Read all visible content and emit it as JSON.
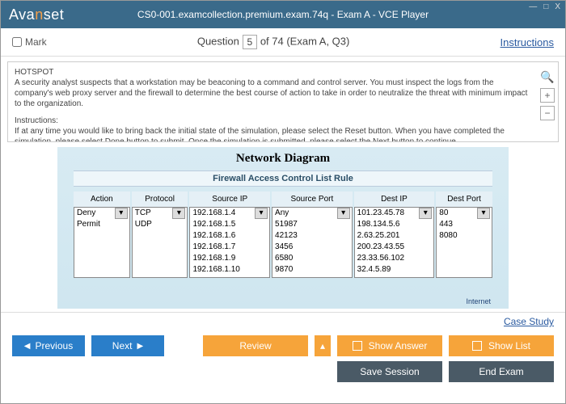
{
  "window": {
    "title": "CS0-001.examcollection.premium.exam.74q - Exam A - VCE Player",
    "logo_pre": "Ava",
    "logo_n": "n",
    "logo_post": "set",
    "min": "—",
    "max": "□",
    "close": "X"
  },
  "qbar": {
    "mark": "Mark",
    "question_label": "Question",
    "current": "5",
    "of": " of 74 (Exam A, Q3)",
    "instructions": "Instructions"
  },
  "question": {
    "heading": "HOTSPOT",
    "body": "A security analyst suspects that a workstation may be beaconing to a command and control server. You must inspect the logs from the company's web proxy server and the firewall to determine the best course of action to take in order to neutralize the threat with minimum impact to the organization.",
    "instr_label": "Instructions:",
    "instr_body": "If at any time you would like to bring back the initial state of the simulation, please select the Reset button. When you have completed the simulation, please select Done button to submit. Once the simulation is submitted, please select the Next button to continue.",
    "zoom_in": "+",
    "zoom_out": "−",
    "mag": "🔍"
  },
  "sim": {
    "title": "Network Diagram",
    "acl_title": "Firewall Access Control List Rule",
    "columns": [
      {
        "h": "Action",
        "opts": [
          "Deny",
          "Permit"
        ]
      },
      {
        "h": "Protocol",
        "opts": [
          "TCP",
          "UDP"
        ]
      },
      {
        "h": "Source IP",
        "opts": [
          "192.168.1.4",
          "192.168.1.5",
          "192.168.1.6",
          "192.168.1.7",
          "192.168.1.9",
          "192.168.1.10"
        ]
      },
      {
        "h": "Source Port",
        "opts": [
          "Any",
          "51987",
          "42123",
          "3456",
          "6580",
          "9870"
        ]
      },
      {
        "h": "Dest IP",
        "opts": [
          "101.23.45.78",
          "198.134.5.6",
          "2.63.25.201",
          "200.23.43.55",
          "23.33.56.102",
          "32.4.5.89"
        ]
      },
      {
        "h": "Dest Port",
        "opts": [
          "80",
          "443",
          "8080"
        ]
      }
    ],
    "internet": "Internet"
  },
  "case_study": "Case Study",
  "buttons": {
    "previous": "Previous",
    "next": "Next",
    "review": "Review",
    "caret": "▴",
    "show_answer": "Show Answer",
    "show_list": "Show List",
    "save_session": "Save Session",
    "end_exam": "End Exam"
  }
}
